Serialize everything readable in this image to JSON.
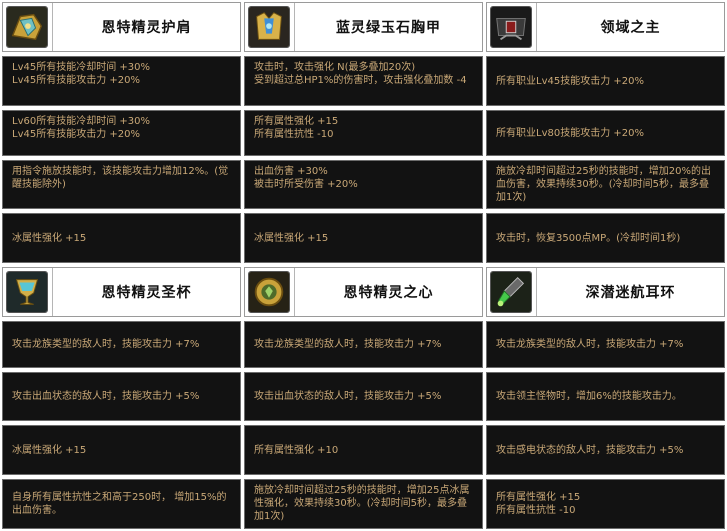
{
  "items": [
    {
      "name": "恩特精灵护肩",
      "icon": "shoulder-armor-icon",
      "stats": [
        "Lv45所有技能冷却时间 +30%\nLv45所有技能攻击力 +20%",
        "Lv60所有技能冷却时间 +30%\nLv45所有技能攻击力 +20%",
        "用指令施放技能时，该技能攻击力增加12%。(觉醒技能除外)",
        "冰属性强化 +15"
      ]
    },
    {
      "name": "蓝灵绿玉石胸甲",
      "icon": "chest-armor-icon",
      "stats": [
        "攻击时，攻击强化 N(最多叠加20次)\n受到超过总HP1%的伤害时，攻击强化叠加数 -4",
        "所有属性强化 +15\n所有属性抗性 -10",
        "出血伤害 +30%\n被击时所受伤害 +20%",
        "冰属性强化 +15"
      ]
    },
    {
      "name": "领域之主",
      "icon": "belt-icon",
      "stats": [
        "所有职业Lv45技能攻击力 +20%",
        "所有职业Lv80技能攻击力 +20%",
        "施放冷却时间超过25秒的技能时，增加20%的出血伤害，效果持续30秒。(冷却时间5秒，最多叠加1次)",
        "攻击时，恢复3500点MP。(冷却时间1秒)"
      ]
    },
    {
      "name": "恩特精灵圣杯",
      "icon": "grail-icon",
      "stats": [
        "攻击龙族类型的敌人时，技能攻击力 +7%",
        "攻击出血状态的敌人时，技能攻击力 +5%",
        "冰属性强化 +15",
        "自身所有属性抗性之和高于250时， 增加15%的出血伤害。"
      ]
    },
    {
      "name": "恩特精灵之心",
      "icon": "heart-emblem-icon",
      "stats": [
        "攻击龙族类型的敌人时，技能攻击力 +7%",
        "攻击出血状态的敌人时，技能攻击力 +5%",
        "所有属性强化 +10",
        "施放冷却时间超过25秒的技能时，增加25点冰属性强化，效果持续30秒。(冷却时间5秒，最多叠加1次)"
      ]
    },
    {
      "name": "深潜迷航耳环",
      "icon": "earring-icon",
      "stats": [
        "攻击龙族类型的敌人时，技能攻击力 +7%",
        "攻击领主怪物时，增加6%的技能攻击力。",
        "攻击感电状态的敌人时，技能攻击力 +5%",
        "所有属性强化 +15\n所有属性抗性 -10"
      ]
    }
  ]
}
